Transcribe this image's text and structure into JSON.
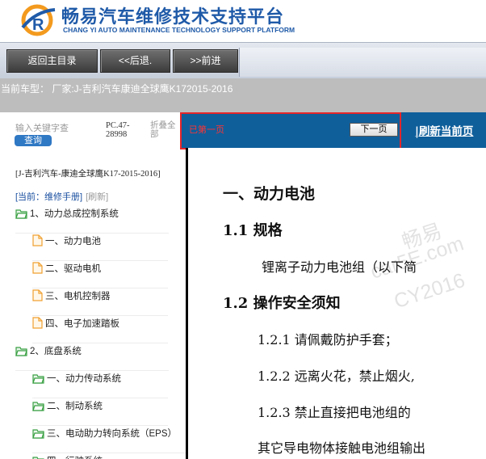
{
  "header": {
    "title": "畅易汽车维修技术支持平台",
    "subtitle": "CHANG YI AUTO MAINTENANCE TECHNOLOGY SUPPORT PLATFORM",
    "logo_letter": "R"
  },
  "toolbar": {
    "home_label": "返回主目录",
    "back_label": "<<后退.",
    "forward_label": ">>前进"
  },
  "vehicle": {
    "current_model": "当前车型：  厂家:J-吉利汽车康迪全球鹰K172015-2016"
  },
  "sidebar": {
    "search_placeholder": "输入关键字查",
    "search_button": "查询",
    "pc_text": "PC.47-28998",
    "collapse_label": "折叠全部",
    "breadcrumb": "[J-吉利汽车-康迪全球鹰K17-2015-2016]",
    "current_label": "[当前：维修手册]",
    "refresh_label": "[刷新]",
    "tree": [
      {
        "label": "1、动力总成控制系统",
        "icon": "folder-open-icon"
      },
      {
        "label": "一、动力电池",
        "icon": "document-icon"
      },
      {
        "label": "二、驱动电机",
        "icon": "document-icon"
      },
      {
        "label": "三、电机控制器",
        "icon": "document-icon"
      },
      {
        "label": "四、电子加速踏板",
        "icon": "document-icon"
      },
      {
        "label": "2、底盘系统",
        "icon": "folder-open-icon"
      },
      {
        "label": "一、动力传动系统",
        "icon": "folder-open-icon"
      },
      {
        "label": "二、制动系统",
        "icon": "folder-open-icon"
      },
      {
        "label": "三、电动助力转向系统（EPS）",
        "icon": "folder-open-icon"
      },
      {
        "label": "四、行驶系统",
        "icon": "folder-open-icon"
      }
    ]
  },
  "content": {
    "page_marker": "已第一页",
    "next_button": "下一页",
    "refresh_label": "|刷新当前页"
  },
  "document": {
    "heading1": "一、动力电池",
    "heading2a": "1.1 规格",
    "para1": "锂离子动力电池组（以下简",
    "heading2b": "1.2 操作安全须知",
    "item121": "1.2.1 请佩戴防护手套；",
    "item122": "1.2.2 远离火花，禁止烟火,",
    "item123": "1.2.3 禁止直接把电池组的",
    "tail": "其它导电物体接触电池组输出"
  },
  "watermark": {
    "line1": "畅易",
    "line2": "car5E.com",
    "line3": "CY2016"
  },
  "colors": {
    "brand_blue": "#1f5aa8",
    "content_bar": "#0f5f9b",
    "highlight": "#e5262a",
    "folder_green": "#3aa043",
    "document_orange": "#f0a030"
  }
}
